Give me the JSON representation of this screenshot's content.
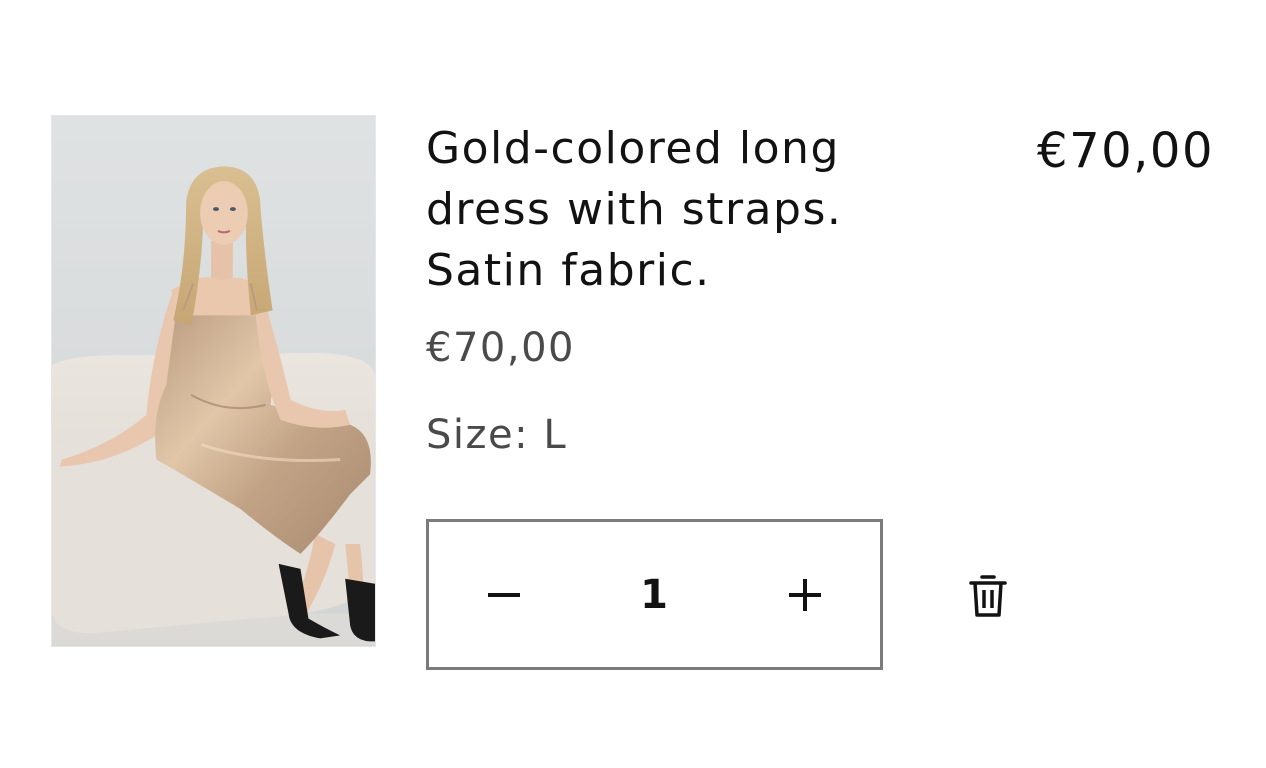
{
  "cart_item": {
    "title": "Gold-colored long dress with straps. Satin fabric.",
    "total_price": "€70,00",
    "unit_price": "€70,00",
    "size_label": "Size:",
    "size_value": "L",
    "quantity": "1",
    "decrease_icon": "minus-icon",
    "increase_icon": "plus-icon",
    "remove_icon": "trash-icon",
    "image_alt": "Model wearing gold satin long dress sitting on a sofa"
  },
  "colors": {
    "text": "#121212",
    "muted_text": "#4a4a4a",
    "border": "#7b7b7b",
    "dress_gold": "#c9a98a"
  }
}
